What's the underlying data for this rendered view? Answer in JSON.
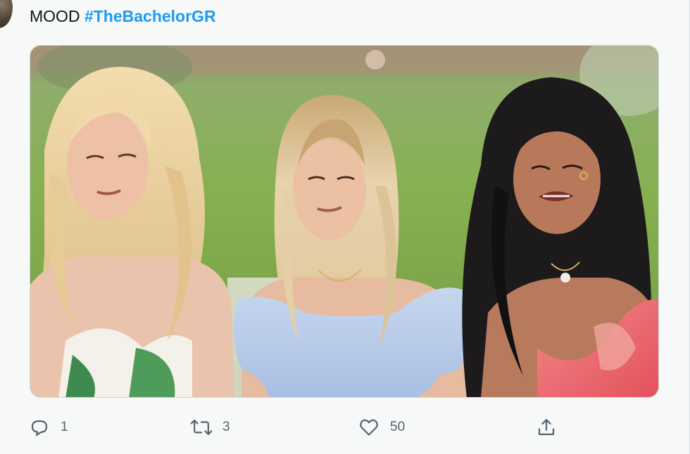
{
  "tweet": {
    "text_prefix": "MOOD ",
    "hashtag": "#TheBachelorGR"
  },
  "media": {
    "alt": "Photo of three women sitting outdoors on a grassy lawn"
  },
  "actions": {
    "reply": {
      "icon": "reply-icon",
      "count": "1"
    },
    "retweet": {
      "icon": "retweet-icon",
      "count": "3"
    },
    "like": {
      "icon": "heart-icon",
      "count": "50"
    },
    "share": {
      "icon": "share-icon"
    }
  },
  "colors": {
    "hashtag": "#1d9bf0",
    "action_gray": "#536471",
    "text": "#0f1419"
  }
}
